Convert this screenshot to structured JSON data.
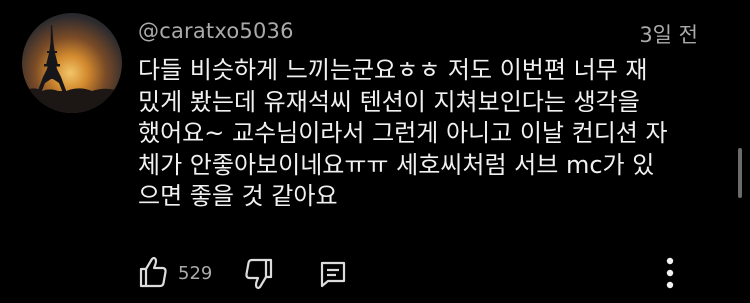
{
  "comment": {
    "username": "@caratxo5036",
    "timestamp": "3일 전",
    "lines": [
      "다들 비슷하게 느끼는군요ㅎㅎ 저도 이번편 너무 재",
      "밌게 봤는데 유재석씨 텐션이 지쳐보인다는 생각을",
      "했어요~ 교수님이라서 그런게 아니고 이날 컨디션 자",
      "체가 안좋아보이네요ㅠㅠ 세호씨처럼 서브 mc가 있",
      "으면 좋을 것 같아요"
    ],
    "like_count": "529"
  },
  "icons": {
    "avatar": "eiffel-tower-sunset-avatar",
    "like": "thumbs-up-icon",
    "dislike": "thumbs-down-icon",
    "reply": "comment-reply-icon",
    "more": "more-vertical-icon"
  },
  "colors": {
    "background": "#000000",
    "text": "#f1f1f1",
    "secondary_text": "#aaaaaa"
  }
}
